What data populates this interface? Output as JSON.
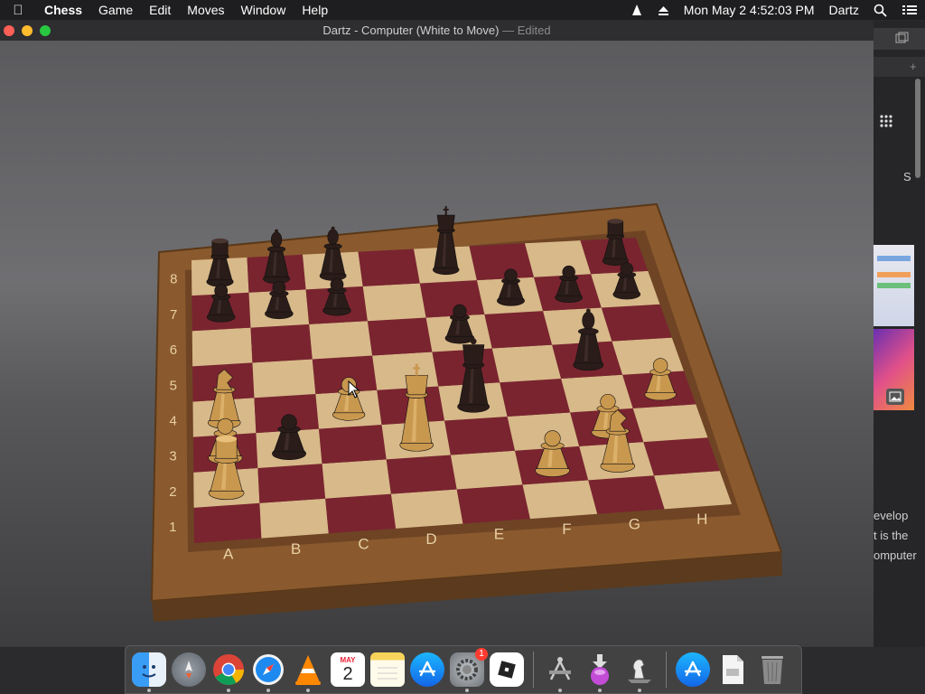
{
  "menubar": {
    "app": "Chess",
    "items": [
      "Game",
      "Edit",
      "Moves",
      "Window",
      "Help"
    ],
    "clock": "Mon May 2  4:52:03 PM",
    "user": "Dartz"
  },
  "window": {
    "title": "Dartz - Computer   (White to Move)",
    "edited": "— Edited"
  },
  "board": {
    "files": [
      "A",
      "B",
      "C",
      "D",
      "E",
      "F",
      "G",
      "H"
    ],
    "ranks": [
      "1",
      "2",
      "3",
      "4",
      "5",
      "6",
      "7",
      "8"
    ],
    "light_square": "#d8b98a",
    "dark_square": "#7a2430",
    "frame_color": "#8a5a2e",
    "pieces": [
      {
        "color": "black",
        "type": "rook",
        "square": "a8"
      },
      {
        "color": "black",
        "type": "bishop",
        "square": "b8"
      },
      {
        "color": "black",
        "type": "bishop",
        "square": "c8"
      },
      {
        "color": "black",
        "type": "king",
        "square": "e8"
      },
      {
        "color": "black",
        "type": "rook",
        "square": "h8"
      },
      {
        "color": "black",
        "type": "pawn",
        "square": "a7"
      },
      {
        "color": "black",
        "type": "pawn",
        "square": "b7"
      },
      {
        "color": "black",
        "type": "pawn",
        "square": "c7"
      },
      {
        "color": "black",
        "type": "pawn",
        "square": "f7"
      },
      {
        "color": "black",
        "type": "pawn",
        "square": "g7"
      },
      {
        "color": "black",
        "type": "pawn",
        "square": "h7"
      },
      {
        "color": "black",
        "type": "pawn",
        "square": "e6"
      },
      {
        "color": "black",
        "type": "bishop",
        "square": "g5"
      },
      {
        "color": "black",
        "type": "queen",
        "square": "e4"
      },
      {
        "color": "black",
        "type": "pawn",
        "square": "b3"
      },
      {
        "color": "white",
        "type": "knight",
        "square": "a4"
      },
      {
        "color": "white",
        "type": "pawn",
        "square": "c4"
      },
      {
        "color": "white",
        "type": "king",
        "square": "d3"
      },
      {
        "color": "white",
        "type": "pawn",
        "square": "h4"
      },
      {
        "color": "white",
        "type": "pawn",
        "square": "a3"
      },
      {
        "color": "white",
        "type": "pawn",
        "square": "g3"
      },
      {
        "color": "white",
        "type": "rook",
        "square": "a2"
      },
      {
        "color": "white",
        "type": "pawn",
        "square": "f2"
      },
      {
        "color": "white",
        "type": "knight",
        "square": "g2"
      }
    ]
  },
  "background_window": {
    "lines": [
      "S",
      "evelop",
      "t is the",
      "omputer"
    ]
  },
  "dock": {
    "badge": "1",
    "calendar_month": "MAY",
    "calendar_day": "2",
    "apps": [
      "finder",
      "launchpad",
      "chrome",
      "safari",
      "vlc",
      "calendar",
      "notes",
      "app-store",
      "system-preferences",
      "roblox",
      "utility",
      "installer",
      "chess",
      "app-store-2",
      "document",
      "trash"
    ]
  }
}
